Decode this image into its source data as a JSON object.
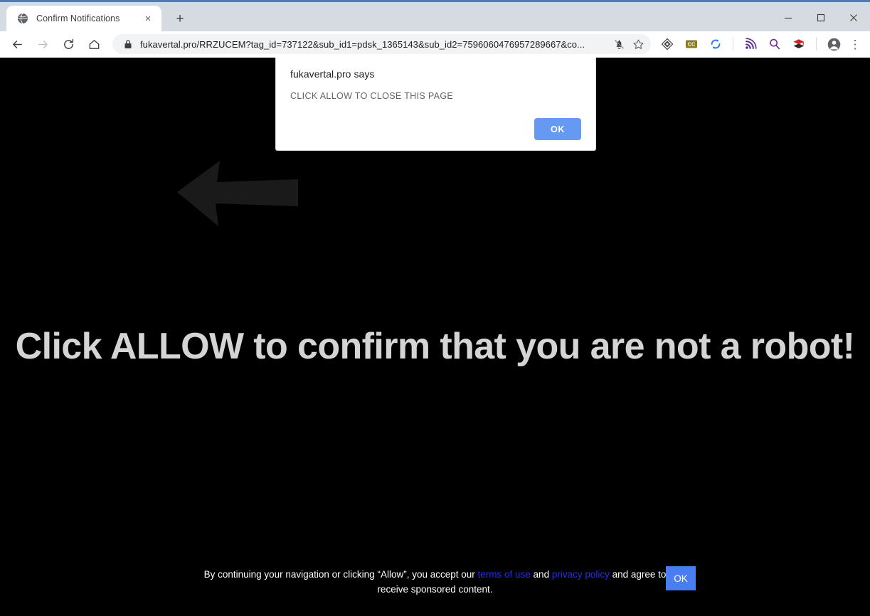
{
  "window": {
    "controls": {
      "minimize": "minimize",
      "maximize": "maximize",
      "close": "close"
    }
  },
  "tabs": [
    {
      "title": "Confirm Notifications",
      "favicon": "globe-icon",
      "close_label": "×"
    }
  ],
  "new_tab_label": "+",
  "toolbar": {
    "back_label": "Back",
    "forward_label": "Forward",
    "reload_label": "Reload",
    "home_label": "Home",
    "url": "fukavertal.pro/RRZUCEM?tag_id=737122&sub_id1=pdsk_1365143&sub_id2=7596060476957289667&co...",
    "lock_icon": "lock-icon",
    "notifications_blocked_icon": "bell-slash-icon",
    "bookmark_icon": "star-icon",
    "extensions": [
      {
        "name": "extension-diamond-icon",
        "label": ""
      },
      {
        "name": "extension-cc-icon",
        "label": "CC"
      },
      {
        "name": "extension-sync-icon",
        "label": ""
      },
      {
        "name": "extension-rss-icon",
        "label": ""
      },
      {
        "name": "extension-search-icon",
        "label": ""
      },
      {
        "name": "extension-graduation-cap-icon",
        "label": ""
      }
    ],
    "profile_icon": "profile-avatar-icon",
    "menu_label": "⋮"
  },
  "dialog": {
    "title": "fukavertal.pro says",
    "message": "CLICK ALLOW TO CLOSE THIS PAGE",
    "ok_label": "OK"
  },
  "page": {
    "headline": "Click ALLOW to confirm that you are not a robot!",
    "arrow_icon": "left-arrow-graphic",
    "background_color": "#000000",
    "headline_color": "#d4d4d4"
  },
  "consent": {
    "text_before_terms": "By continuing your navigation or clicking “Allow”, you accept our ",
    "terms_link": "terms of use",
    "text_between_links": " and ",
    "privacy_link": "privacy policy",
    "text_after_links": " and agree to receive sponsored content.",
    "ok_label": "OK",
    "link_color": "#2a2aee",
    "ok_button_color": "#4a7ef0"
  }
}
